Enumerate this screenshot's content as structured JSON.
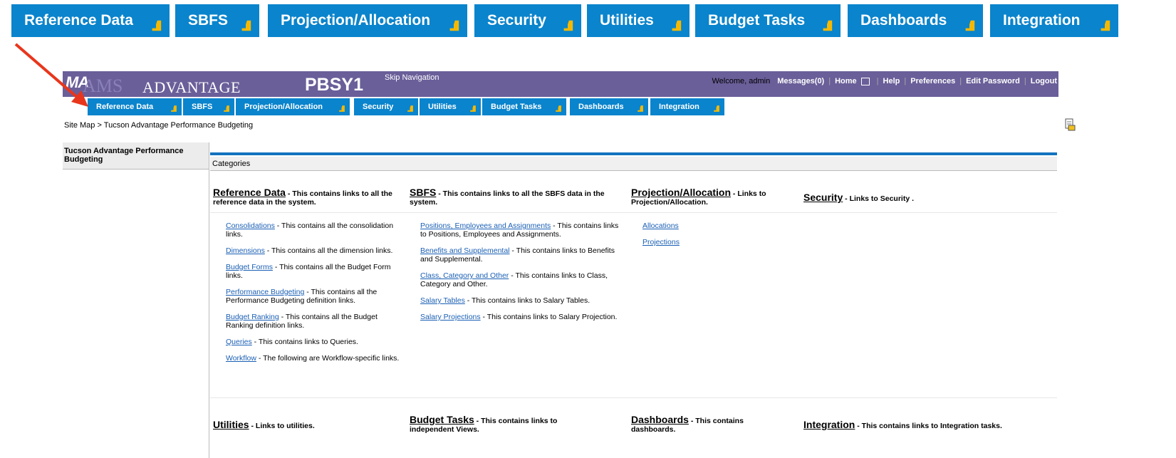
{
  "colors": {
    "tab_blue": "#0a84cc",
    "header_purple": "#6a5f99",
    "arrow_yellow": "#f5b800",
    "link_blue": "#1a5fb4",
    "annotation_red": "#e8361c"
  },
  "big_tabs": [
    {
      "label": "Reference Data"
    },
    {
      "label": "SBFS"
    },
    {
      "label": "Projection/Allocation"
    },
    {
      "label": "Security"
    },
    {
      "label": "Utilities"
    },
    {
      "label": "Budget Tasks"
    },
    {
      "label": "Dashboards"
    },
    {
      "label": "Integration"
    }
  ],
  "header": {
    "logo_ma": "MA",
    "logo_ams": "AMS",
    "logo_advantage": "ADVANTAGE",
    "env_name": "PBSY1",
    "skip_nav": "Skip Navigation",
    "welcome": "Welcome, admin",
    "messages": "Messages(0)",
    "home": "Home",
    "help": "Help",
    "preferences": "Preferences",
    "edit_password": "Edit Password",
    "logout": "Logout"
  },
  "small_tabs": [
    {
      "label": "Reference Data"
    },
    {
      "label": "SBFS"
    },
    {
      "label": "Projection/Allocation"
    },
    {
      "label": "Security"
    },
    {
      "label": "Utilities"
    },
    {
      "label": "Budget Tasks"
    },
    {
      "label": "Dashboards"
    },
    {
      "label": "Integration"
    }
  ],
  "breadcrumb": {
    "root": "Site Map",
    "sep": ">",
    "current": "Tucson Advantage Performance Budgeting"
  },
  "leftnav": {
    "title": "Tucson Advantage Performance Budgeting"
  },
  "categories_label": "Categories",
  "sections": {
    "reference": {
      "title": "Reference Data",
      "desc": " - This contains links to all the reference data in the system."
    },
    "sbfs": {
      "title": "SBFS",
      "desc": " - This contains links to all the SBFS data in the system."
    },
    "projection": {
      "title": "Projection/Allocation",
      "desc": " - Links to Projection/Allocation."
    },
    "security": {
      "title": "Security",
      "desc": " - Links to Security ."
    },
    "utilities": {
      "title": "Utilities",
      "desc": " - Links to utilities."
    },
    "budget_tasks": {
      "title": "Budget Tasks",
      "desc": " - This contains links to independent Views."
    },
    "dashboards": {
      "title": "Dashboards",
      "desc": " - This contains dashboards."
    },
    "integration": {
      "title": "Integration",
      "desc": " - This contains links to Integration tasks."
    }
  },
  "reference_items": [
    {
      "link": "Consolidations",
      "desc": " - This contains all the consolidation links."
    },
    {
      "link": "Dimensions",
      "desc": " - This contains all the dimension links."
    },
    {
      "link": "Budget Forms",
      "desc": " - This contains all the Budget Form links."
    },
    {
      "link": "Performance Budgeting",
      "desc": " - This contains all the Performance Budgeting definition links."
    },
    {
      "link": "Budget Ranking",
      "desc": " - This contains all the Budget Ranking definition links."
    },
    {
      "link": "Queries",
      "desc": " - This contains links to Queries."
    },
    {
      "link": "Workflow",
      "desc": " - The following are Workflow-specific links."
    }
  ],
  "sbfs_items": [
    {
      "link": "Positions, Employees and Assignments",
      "desc": " - This contains links to Positions, Employees and Assignments."
    },
    {
      "link": "Benefits and Supplemental",
      "desc": " - This contains links to Benefits and Supplemental."
    },
    {
      "link": "Class, Category and Other",
      "desc": " - This contains links to Class, Category and Other."
    },
    {
      "link": "Salary Tables",
      "desc": " - This contains links to Salary Tables."
    },
    {
      "link": "Salary Projections",
      "desc": " - This contains links to Salary Projection."
    }
  ],
  "projection_items": [
    {
      "link": "Allocations"
    },
    {
      "link": "Projections"
    }
  ]
}
